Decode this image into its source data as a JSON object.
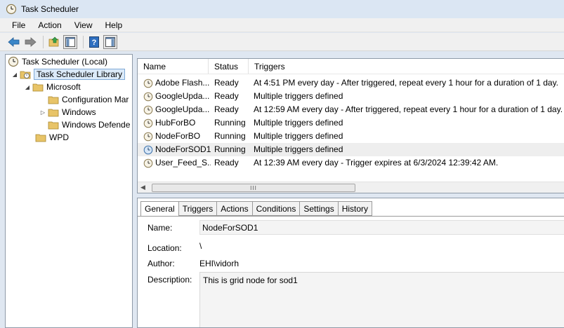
{
  "window": {
    "title": "Task Scheduler"
  },
  "menu": [
    "File",
    "Action",
    "View",
    "Help"
  ],
  "toolbar": {
    "icons": [
      "back-icon",
      "forward-icon",
      "up-folder-icon",
      "show-hide-tree-icon",
      "help-icon",
      "show-hide-action-pane-icon"
    ]
  },
  "tree": {
    "root": "Task Scheduler (Local)",
    "library": "Task Scheduler Library",
    "microsoft": "Microsoft",
    "configuration": "Configuration Mar",
    "windows": "Windows",
    "defender": "Windows Defende",
    "wpd": "WPD"
  },
  "list": {
    "columns": [
      "Name",
      "Status",
      "Triggers"
    ],
    "rows": [
      {
        "name": "Adobe Flash...",
        "status": "Ready",
        "triggers": "At 4:51 PM every day - After triggered, repeat every 1 hour for a duration of 1 day."
      },
      {
        "name": "GoogleUpda...",
        "status": "Ready",
        "triggers": "Multiple triggers defined"
      },
      {
        "name": "GoogleUpda...",
        "status": "Ready",
        "triggers": "At 12:59 AM every day - After triggered, repeat every 1 hour for a duration of 1 day."
      },
      {
        "name": "HubForBO",
        "status": "Running",
        "triggers": "Multiple triggers defined"
      },
      {
        "name": "NodeForBO",
        "status": "Running",
        "triggers": "Multiple triggers defined"
      },
      {
        "name": "NodeForSOD1",
        "status": "Running",
        "triggers": "Multiple triggers defined"
      },
      {
        "name": "User_Feed_S...",
        "status": "Ready",
        "triggers": "At 12:39 AM every day - Trigger expires at 6/3/2024 12:39:42 AM."
      }
    ],
    "scroll_grip": "III"
  },
  "detail": {
    "tabs": [
      "General",
      "Triggers",
      "Actions",
      "Conditions",
      "Settings",
      "History"
    ],
    "labels": {
      "name": "Name:",
      "location": "Location:",
      "author": "Author:",
      "description": "Description:"
    },
    "values": {
      "name": "NodeForSOD1",
      "location": "\\",
      "author": "EHI\\vidorh",
      "description": "This is grid node for sod1"
    }
  },
  "colors": {
    "accent": "#7fa9d6",
    "folder": "#e8c468",
    "selection": "#dbeaf9"
  }
}
